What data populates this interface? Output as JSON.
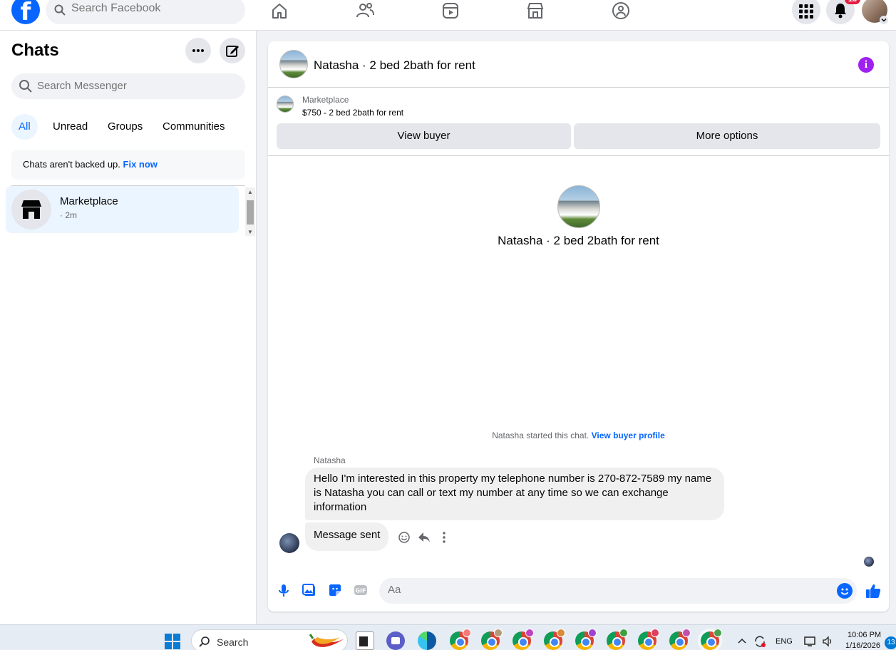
{
  "topbar": {
    "search_placeholder": "Search Facebook",
    "notification_count": "13",
    "logo_letter": "f"
  },
  "left": {
    "title": "Chats",
    "search_placeholder": "Search Messenger",
    "filters": [
      "All",
      "Unread",
      "Groups",
      "Communities"
    ],
    "backup_text": "Chats aren't backed up.",
    "backup_link": "Fix now",
    "chats": [
      {
        "name": "Marketplace",
        "time": "· 2m"
      }
    ]
  },
  "conversation": {
    "title": "Natasha · 2 bed 2bath for rent",
    "marketplace_label": "Marketplace",
    "listing": "$750 - 2 bed 2bath for rent",
    "view_buyer_label": "View buyer",
    "more_options_label": "More options",
    "profile_title": "Natasha · 2 bed 2bath for rent",
    "started_text": "Natasha started this chat.",
    "started_link": "View buyer profile",
    "sender_name": "Natasha",
    "messages": [
      "Hello I'm interested in this property my telephone number is 270-872-7589 my name is Natasha you can call or text my number at any time so we can exchange information",
      "Message sent"
    ],
    "composer_placeholder": "Aa"
  },
  "taskbar": {
    "search_label": "Search",
    "language": "ENG",
    "time": "10:06 PM",
    "date": "1/16/2026",
    "notification_count": "13"
  },
  "colors": {
    "accent": "#0866ff",
    "info": "#a020f0",
    "badge": "#e41e3f"
  }
}
